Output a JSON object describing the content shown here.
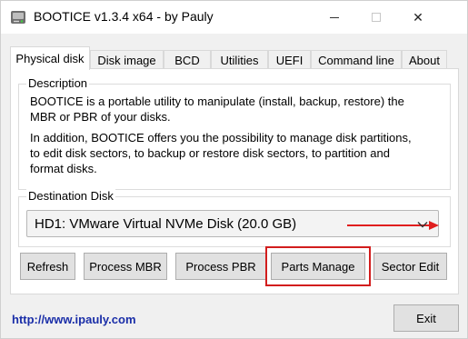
{
  "window": {
    "title": "BOOTICE v1.3.4 x64 - by Pauly",
    "icons": {
      "app": "disk-app-icon",
      "minimize": "minimize-icon",
      "maximize": "maximize-icon",
      "close": "close-icon"
    },
    "close_symbol": "✕"
  },
  "tabs": [
    {
      "label": "Physical disk",
      "active": true
    },
    {
      "label": "Disk image",
      "active": false
    },
    {
      "label": "BCD",
      "active": false
    },
    {
      "label": "Utilities",
      "active": false
    },
    {
      "label": "UEFI",
      "active": false
    },
    {
      "label": "Command line",
      "active": false
    },
    {
      "label": "About",
      "active": false
    }
  ],
  "description": {
    "legend": "Description",
    "paragraph1_line1": "BOOTICE is a portable utility to manipulate (install, backup, restore) the",
    "paragraph1_line2": "MBR or PBR of your disks.",
    "paragraph2_line1": "In addition, BOOTICE offers you the possibility to manage disk partitions,",
    "paragraph2_line2": "to edit disk sectors, to backup or restore disk sectors, to partition and",
    "paragraph2_line3": "format disks."
  },
  "destination": {
    "legend": "Destination Disk",
    "selected": "HD1: VMware Virtual NVMe Disk (20.0 GB)",
    "chevron_icon": "chevron-down-icon",
    "annotation_arrow_color": "#e01e1e"
  },
  "buttons": {
    "refresh": "Refresh",
    "process_mbr": "Process MBR",
    "process_pbr": "Process PBR",
    "parts_manage": "Parts Manage",
    "sector_edit": "Sector Edit",
    "exit": "Exit"
  },
  "highlight_color": "#d21d1d",
  "footer": {
    "link": "http://www.ipauly.com",
    "link_color": "#1a2ea8"
  }
}
